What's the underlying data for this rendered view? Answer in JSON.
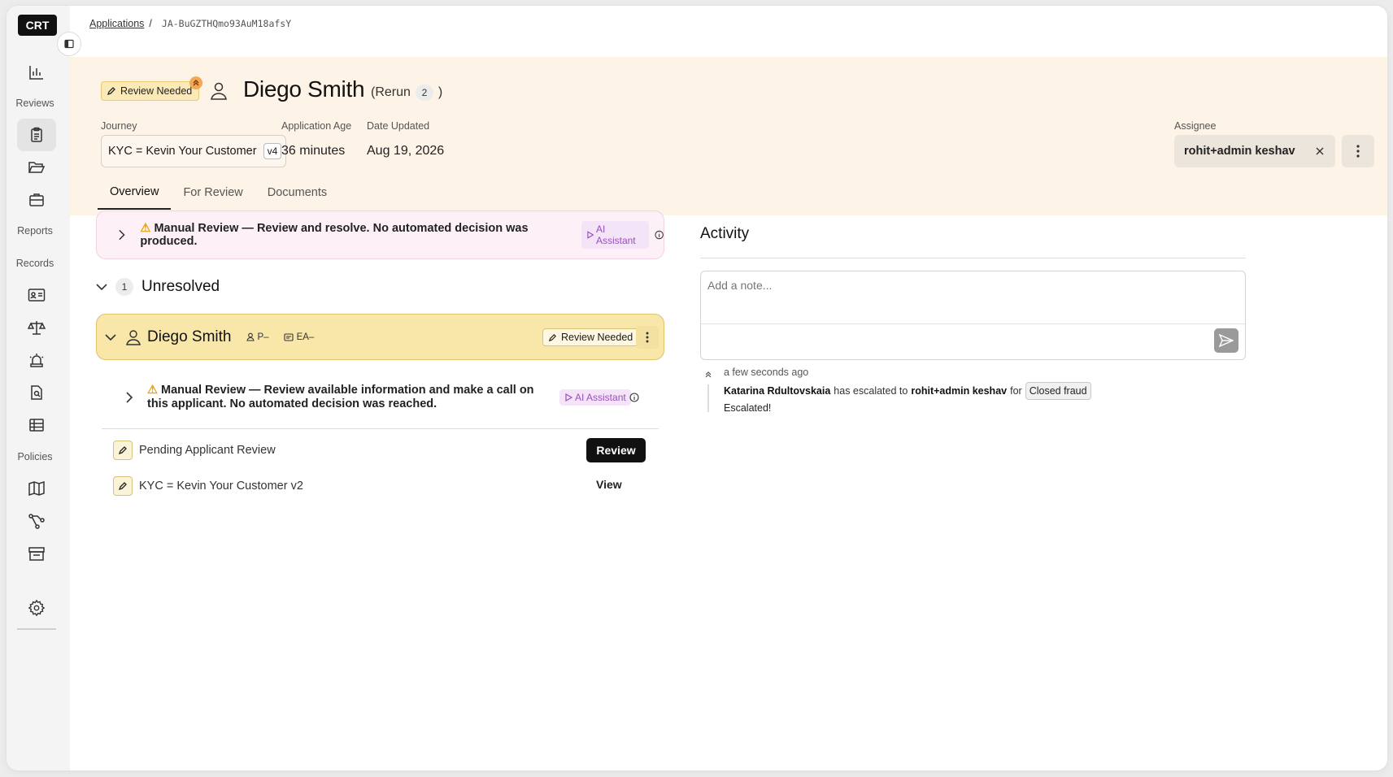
{
  "sidebar": {
    "logo": "CRT",
    "sections": {
      "reviews": "Reviews",
      "reports": "Reports",
      "records": "Records",
      "policies": "Policies"
    }
  },
  "breadcrumb": {
    "root": "Applications",
    "separator": "/",
    "id": "JA-BuGZTHQmo93AuM18afsY"
  },
  "header": {
    "status": "Review Needed",
    "name": "Diego Smith",
    "rerun_label": "(Rerun",
    "rerun_count": "2",
    "rerun_close": ")",
    "journey_label": "Journey",
    "journey_value": "KYC = Kevin Your Customer",
    "journey_version": "v4",
    "age_label": "Application Age",
    "age_value": "36 minutes",
    "updated_label": "Date Updated",
    "updated_value": "Aug 19, 2026",
    "assignee_label": "Assignee",
    "assignee_value": "rohit+admin keshav"
  },
  "tabs": [
    "Overview",
    "For Review",
    "Documents"
  ],
  "banner": {
    "message": "Manual Review — Review and resolve. No automated decision was produced.",
    "ai_label": "AI Assistant"
  },
  "unresolved": {
    "count": "1",
    "label": "Unresolved"
  },
  "applicant": {
    "name": "Diego Smith",
    "person_meta": "P–",
    "entity_meta": "EA–",
    "status": "Review Needed",
    "review_message": "Manual Review — Review available information and make a call on this applicant. No automated decision was reached.",
    "ai_label": "AI Assistant"
  },
  "tasks": [
    {
      "label": "Pending Applicant Review",
      "action": "Review"
    },
    {
      "label": "KYC = Kevin Your Customer v2",
      "action": "View"
    }
  ],
  "activity": {
    "title": "Activity",
    "placeholder": "Add a note...",
    "time": "a few seconds ago",
    "actor": "Katarina Rdultovskaia",
    "verb": "has escalated to",
    "target": "rohit+admin keshav",
    "for": "for",
    "reason": "Closed fraud",
    "note": "Escalated!"
  },
  "colors": {
    "header_bg": "#fdf3e7",
    "card_bg": "#f8e7a8",
    "banner_bg": "#fdf0f7",
    "ai_accent": "#9a4fc0",
    "warning": "#e8a10b"
  }
}
